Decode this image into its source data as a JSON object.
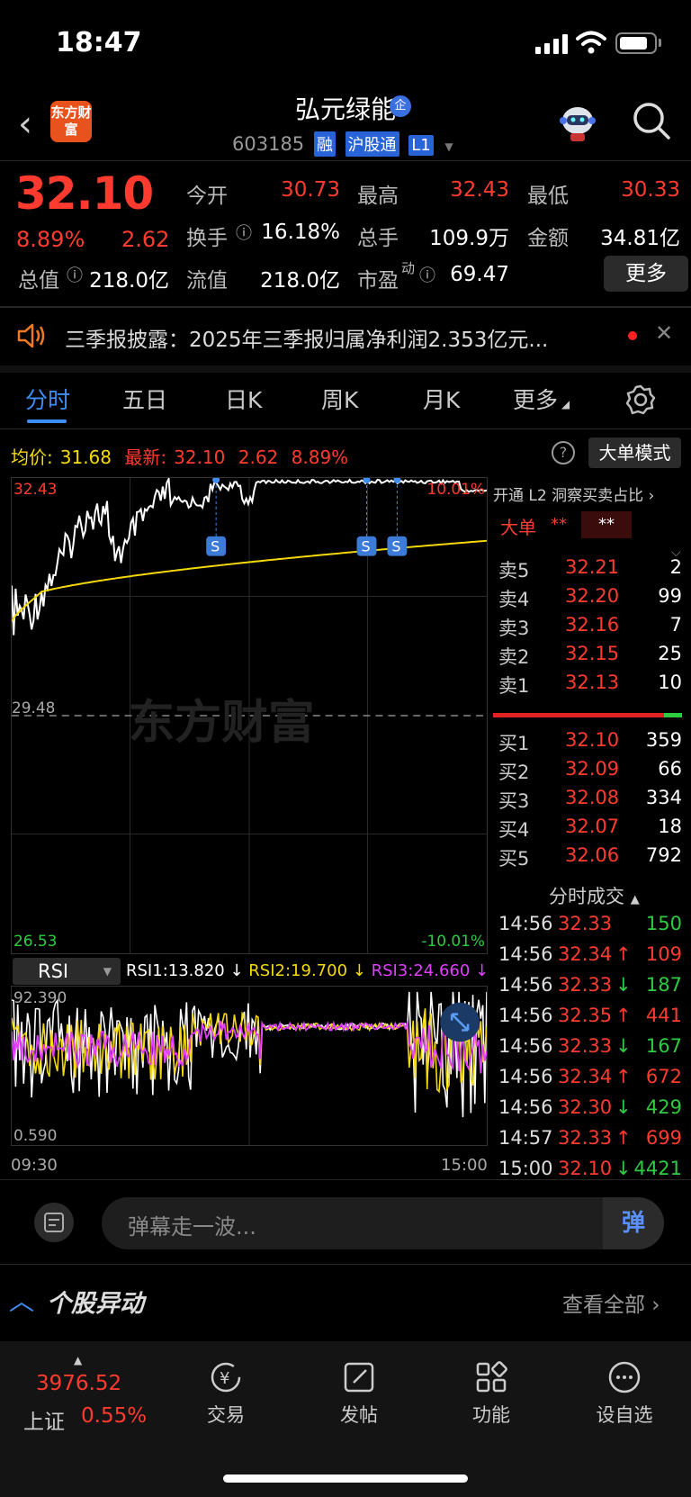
{
  "status_bar": {
    "time": "18:47"
  },
  "header": {
    "logo_text": "东方财富",
    "stock_name": "弘元绿能",
    "name_badge": "企",
    "code": "603185",
    "tags": [
      "融",
      "沪股通",
      "L1"
    ]
  },
  "quote": {
    "price": "32.10",
    "change_pct": "8.89%",
    "change": "2.62",
    "fields": [
      {
        "label": "今开",
        "value": "30.73",
        "color": "red"
      },
      {
        "label": "最高",
        "value": "32.43",
        "color": "red"
      },
      {
        "label": "最低",
        "value": "30.33",
        "color": "red"
      },
      {
        "label": "换手",
        "value": "16.18%",
        "color": "white"
      },
      {
        "label": "总手",
        "value": "109.9万",
        "color": "white"
      },
      {
        "label": "金额",
        "value": "34.81亿",
        "color": "white"
      },
      {
        "label": "总值",
        "value": "218.0亿",
        "color": "white"
      },
      {
        "label": "流值",
        "value": "218.0亿",
        "color": "white"
      },
      {
        "label": "市盈",
        "label_sup": "动",
        "value": "69.47",
        "color": "white"
      }
    ],
    "more_button": "更多"
  },
  "notice": {
    "text": "三季报披露：2025年三季报归属净利润2.353亿元..."
  },
  "tabs": [
    "分时",
    "五日",
    "日K",
    "周K",
    "月K",
    "更多"
  ],
  "info_row": {
    "avg_label": "均价:",
    "avg_value": "31.68",
    "last_label": "最新:",
    "last_value": "32.10",
    "change": "2.62",
    "change_pct": "8.89%",
    "mode_button": "大单模式"
  },
  "chart": {
    "y_top": "32.43",
    "y_mid": "29.48",
    "y_bottom": "26.53",
    "pct_top": "10.01%",
    "pct_bottom": "-10.01%",
    "watermark": "东方财富",
    "marker": "S"
  },
  "order_book": {
    "header": "开通 L2 洞察买卖占比",
    "big_order_label": "大单",
    "big_order_a": "**",
    "big_order_b": "**",
    "sell": [
      {
        "label": "卖5",
        "price": "32.21",
        "vol": "2"
      },
      {
        "label": "卖4",
        "price": "32.20",
        "vol": "99"
      },
      {
        "label": "卖3",
        "price": "32.16",
        "vol": "7"
      },
      {
        "label": "卖2",
        "price": "32.15",
        "vol": "25"
      },
      {
        "label": "卖1",
        "price": "32.13",
        "vol": "10"
      }
    ],
    "buy": [
      {
        "label": "买1",
        "price": "32.10",
        "vol": "359"
      },
      {
        "label": "买2",
        "price": "32.09",
        "vol": "66"
      },
      {
        "label": "买3",
        "price": "32.08",
        "vol": "334"
      },
      {
        "label": "买4",
        "price": "32.07",
        "vol": "18"
      },
      {
        "label": "买5",
        "price": "32.06",
        "vol": "792"
      }
    ],
    "trades_title": "分时成交",
    "trades": [
      {
        "time": "14:56",
        "price": "32.33",
        "arrow": "",
        "vol": "150",
        "dir": "green"
      },
      {
        "time": "14:56",
        "price": "32.34",
        "arrow": "↑",
        "vol": "109",
        "dir": "red"
      },
      {
        "time": "14:56",
        "price": "32.33",
        "arrow": "↓",
        "vol": "187",
        "dir": "green"
      },
      {
        "time": "14:56",
        "price": "32.35",
        "arrow": "↑",
        "vol": "441",
        "dir": "red"
      },
      {
        "time": "14:56",
        "price": "32.33",
        "arrow": "↓",
        "vol": "167",
        "dir": "green"
      },
      {
        "time": "14:56",
        "price": "32.34",
        "arrow": "↑",
        "vol": "672",
        "dir": "red"
      },
      {
        "time": "14:56",
        "price": "32.30",
        "arrow": "↓",
        "vol": "429",
        "dir": "green"
      },
      {
        "time": "14:57",
        "price": "32.33",
        "arrow": "↑",
        "vol": "699",
        "dir": "red"
      },
      {
        "time": "15:00",
        "price": "32.10",
        "arrow": "↓",
        "vol": "4421",
        "dir": "green"
      }
    ]
  },
  "rsi": {
    "selector": "RSI",
    "rsi1": "RSI1:13.820 ↓",
    "rsi2": "RSI2:19.700 ↓",
    "rsi3": "RSI3:24.660 ↓",
    "y_top": "92.390",
    "y_bottom": "0.590",
    "x_start": "09:30",
    "x_end": "15:00"
  },
  "comment": {
    "placeholder": "弹幕走一波...",
    "send_label": "弹"
  },
  "section": {
    "title": "个股异动",
    "view_all": "查看全部"
  },
  "bottom_nav": {
    "index_value": "3976.52",
    "index_name": "上证",
    "index_pct": "0.55%",
    "items": [
      "交易",
      "发帖",
      "功能",
      "设自选"
    ]
  },
  "colors": {
    "up": "#ff3b30",
    "down": "#2ecc40",
    "accent": "#3d8ff5",
    "avg_line": "#f5d90a",
    "rsi3": "#e040fb"
  }
}
